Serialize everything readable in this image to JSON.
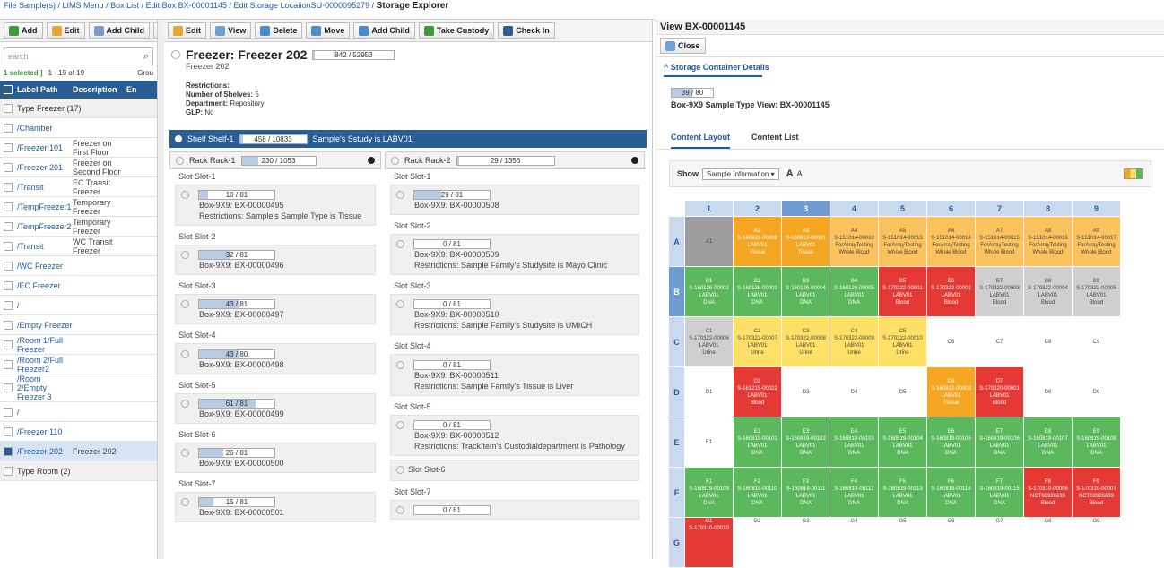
{
  "breadcrumb": {
    "items": [
      "File Sample(s)",
      "LIMS Menu",
      "Box List",
      "Edit Box BX-00001145",
      "Edit Storage LocationSU-0000095279"
    ],
    "current": "Storage Explorer"
  },
  "left_toolbar": {
    "add": "Add",
    "edit": "Edit",
    "add_child": "Add Child",
    "more": "L"
  },
  "left": {
    "search_placeholder": "earch",
    "selected": "1 selected ]",
    "range": "1 - 19 of 19",
    "group_label": "Grou",
    "col_label_path": "Label Path",
    "col_description": "Description",
    "col_extra": "En",
    "rows": [
      {
        "path": "Type Freezer (17)",
        "desc": "",
        "group": true,
        "checked": false
      },
      {
        "path": "/Chamber",
        "desc": "",
        "checked": false
      },
      {
        "path": "/Freezer 101",
        "desc": "Freezer on First Floor",
        "checked": false
      },
      {
        "path": "/Freezer 201",
        "desc": "Freezer on Second Floor",
        "checked": false
      },
      {
        "path": "/Transit",
        "desc": "EC Transit Freezer",
        "checked": false
      },
      {
        "path": "/TempFreezer1",
        "desc": "Temporary Freezer",
        "checked": false
      },
      {
        "path": "/TempFreezer2",
        "desc": "Temporary Freezer",
        "checked": false
      },
      {
        "path": "/Transit",
        "desc": "WC Transit Freezer",
        "checked": false
      },
      {
        "path": "/WC Freezer",
        "desc": "",
        "checked": false
      },
      {
        "path": "/EC Freezer",
        "desc": "",
        "checked": false
      },
      {
        "path": "/",
        "desc": "",
        "checked": false
      },
      {
        "path": "/Empty Freezer",
        "desc": "",
        "checked": false
      },
      {
        "path": "/Room 1/Full Freezer",
        "desc": "",
        "checked": false
      },
      {
        "path": "/Room 2/Full Freezer2",
        "desc": "",
        "checked": false
      },
      {
        "path": "/Room 2/Empty Freezer 3",
        "desc": "",
        "checked": false
      },
      {
        "path": "/",
        "desc": "",
        "checked": false
      },
      {
        "path": "/Freezer 110",
        "desc": "",
        "checked": false
      },
      {
        "path": "/Freezer 202",
        "desc": "Freezer 202",
        "checked": true
      },
      {
        "path": "Type Room (2)",
        "desc": "",
        "group": true,
        "checked": false
      }
    ]
  },
  "mid_toolbar": {
    "edit": "Edit",
    "view": "View",
    "delete": "Delete",
    "move": "Move",
    "add_child": "Add Child",
    "take_custody": "Take Custody",
    "check_in": "Check In"
  },
  "freezer": {
    "title": "Freezer: Freezer 202",
    "capacity": "842 / 52953",
    "capacity_fill": 0.016,
    "subtitle": "Freezer 202",
    "restrictions": "Restrictions:",
    "shelves_label": "Number of Shelves:",
    "shelves": "5",
    "dept_label": "Department:",
    "dept": "Repository",
    "glp_label": "GLP:",
    "glp": "No"
  },
  "shelf": {
    "label": "Shelf Shelf-1",
    "capacity": "458 / 10833",
    "fill": 0.042,
    "note": "Sample's Sstudy is LABV01"
  },
  "rack1": {
    "label": "Rack Rack-1",
    "capacity": "230 / 1053",
    "fill": 0.22,
    "slots": [
      {
        "label": "Slot Slot-1",
        "cap": "10 / 81",
        "fill": 0.12,
        "box": "Box-9X9: BX-00000495",
        "restr": "Restrictions: Sample's Sample Type is Tissue"
      },
      {
        "label": "Slot Slot-2",
        "cap": "32 / 81",
        "fill": 0.4,
        "box": "Box-9X9: BX-00000496",
        "restr": ""
      },
      {
        "label": "Slot Slot-3",
        "cap": "43 / 81",
        "fill": 0.53,
        "box": "Box-9X9: BX-00000497",
        "restr": ""
      },
      {
        "label": "Slot Slot-4",
        "cap": "43 / 80",
        "fill": 0.54,
        "box": "Box-9X9: BX-00000498",
        "restr": ""
      },
      {
        "label": "Slot Slot-5",
        "cap": "61 / 81",
        "fill": 0.75,
        "box": "Box-9X9: BX-00000499",
        "restr": ""
      },
      {
        "label": "Slot Slot-6",
        "cap": "26 / 81",
        "fill": 0.32,
        "box": "Box-9X9: BX-00000500",
        "restr": ""
      },
      {
        "label": "Slot Slot-7",
        "cap": "15 / 81",
        "fill": 0.19,
        "box": "Box-9X9: BX-00000501",
        "restr": ""
      }
    ]
  },
  "rack2": {
    "label": "Rack Rack-2",
    "capacity": "29 / 1356",
    "fill": 0.02,
    "slots": [
      {
        "label": "Slot Slot-1",
        "cap": "29 / 81",
        "fill": 0.36,
        "box": "Box-9X9: BX-00000508",
        "restr": ""
      },
      {
        "label": "Slot Slot-2",
        "cap": "0 / 81",
        "fill": 0,
        "box": "Box-9X9: BX-00000509",
        "restr": "Restrictions: Sample Family's Studysite is Mayo Clinic"
      },
      {
        "label": "Slot Slot-3",
        "cap": "0 / 81",
        "fill": 0,
        "box": "Box-9X9: BX-00000510",
        "restr": "Restrictions: Sample Family's Studysite is UMICH"
      },
      {
        "label": "Slot Slot-4",
        "cap": "0 / 81",
        "fill": 0,
        "box": "Box-9X9: BX-00000511",
        "restr": "Restrictions: Sample Family's Tissue is Liver"
      },
      {
        "label": "Slot Slot-5",
        "cap": "0 / 81",
        "fill": 0,
        "box": "Box-9X9: BX-00000512",
        "restr": "Restrictions: TrackItem's Custodialdepartment is Pathology"
      },
      {
        "label": "Slot Slot-6",
        "cap": "",
        "fill": 0,
        "box": "",
        "restr": ""
      },
      {
        "label": "Slot Slot-7",
        "cap": "0 / 81",
        "fill": 0,
        "box": "",
        "restr": ""
      }
    ]
  },
  "view": {
    "title": "View BX-00001145",
    "close": "Close",
    "section": "Storage Container Details",
    "capacity": "39 / 80",
    "fill": 0.49,
    "box_type": "Box-9X9 Sample Type View: BX-00001145",
    "tab_layout": "Content Layout",
    "tab_list": "Content List",
    "show_label": "Show",
    "show_value": "Sample Information",
    "font_up": "A",
    "font_down": "A"
  },
  "colors": {
    "gray": "#9e9e9e",
    "orange": "#f5a623",
    "yellow": "#ffe066",
    "green": "#5cb85c",
    "red": "#e53935",
    "lightgray": "#cfcfcf",
    "white": "#ffffff",
    "orange2": "#fbc25d"
  },
  "grid": {
    "cols": [
      "1",
      "2",
      "3",
      "4",
      "5",
      "6",
      "7",
      "8",
      "9"
    ],
    "rows": [
      {
        "label": "A",
        "cells": [
          {
            "pos": "A1",
            "lines": [],
            "c": "gray"
          },
          {
            "pos": "A2",
            "lines": [
              "S-160812-00002",
              "LABV01",
              "Tissue"
            ],
            "c": "orange"
          },
          {
            "pos": "A3",
            "lines": [
              "S-160812-00001",
              "LABV01",
              "Tissue"
            ],
            "c": "orange"
          },
          {
            "pos": "A4",
            "lines": [
              "S-151014-00012",
              "ForArrayTesting",
              "Whole Blood"
            ],
            "c": "orange2"
          },
          {
            "pos": "A5",
            "lines": [
              "S-151014-00013",
              "ForArrayTesting",
              "Whole Blood"
            ],
            "c": "orange2"
          },
          {
            "pos": "A6",
            "lines": [
              "S-151014-00014",
              "ForArrayTesting",
              "Whole Blood"
            ],
            "c": "orange2"
          },
          {
            "pos": "A7",
            "lines": [
              "S-151014-00015",
              "ForArrayTesting",
              "Whole Blood"
            ],
            "c": "orange2"
          },
          {
            "pos": "A8",
            "lines": [
              "S-151014-00016",
              "ForArrayTesting",
              "Whole Blood"
            ],
            "c": "orange2"
          },
          {
            "pos": "A9",
            "lines": [
              "S-151014-00017",
              "ForArrayTesting",
              "Whole Blood"
            ],
            "c": "orange2"
          }
        ]
      },
      {
        "label": "B",
        "cells": [
          {
            "pos": "B1",
            "lines": [
              "S-160126-00002",
              "LABV01",
              "DNA"
            ],
            "c": "green"
          },
          {
            "pos": "B2",
            "lines": [
              "S-160126-00003",
              "LABV01",
              "DNA"
            ],
            "c": "green"
          },
          {
            "pos": "B3",
            "lines": [
              "S-160126-00004",
              "LABV01",
              "DNA"
            ],
            "c": "green"
          },
          {
            "pos": "B4",
            "lines": [
              "S-160126-00005",
              "LABV01",
              "DNA"
            ],
            "c": "green"
          },
          {
            "pos": "B5",
            "lines": [
              "S-170322-00001",
              "LABV01",
              "Blood"
            ],
            "c": "red"
          },
          {
            "pos": "B6",
            "lines": [
              "S-170322-00002",
              "LABV01",
              "Blood"
            ],
            "c": "red"
          },
          {
            "pos": "B7",
            "lines": [
              "S-170322-00003",
              "LABV01",
              "Blood"
            ],
            "c": "lightgray"
          },
          {
            "pos": "B8",
            "lines": [
              "S-170322-00004",
              "LABV01",
              "Blood"
            ],
            "c": "lightgray"
          },
          {
            "pos": "B9",
            "lines": [
              "S-170322-00005",
              "LABV01",
              "Blood"
            ],
            "c": "lightgray"
          }
        ]
      },
      {
        "label": "C",
        "cells": [
          {
            "pos": "C1",
            "lines": [
              "S-170322-00006",
              "LABV01",
              "Urine"
            ],
            "c": "lightgray"
          },
          {
            "pos": "C2",
            "lines": [
              "S-170322-00007",
              "LABV01",
              "Urine"
            ],
            "c": "yellow"
          },
          {
            "pos": "C3",
            "lines": [
              "S-170322-00008",
              "LABV01",
              "Urine"
            ],
            "c": "yellow"
          },
          {
            "pos": "C4",
            "lines": [
              "S-170322-00009",
              "LABV01",
              "Urine"
            ],
            "c": "yellow"
          },
          {
            "pos": "C5",
            "lines": [
              "S-170322-00010",
              "LABV01",
              "Urine"
            ],
            "c": "yellow"
          },
          {
            "pos": "C6",
            "lines": [],
            "c": "white"
          },
          {
            "pos": "C7",
            "lines": [],
            "c": "white"
          },
          {
            "pos": "C8",
            "lines": [],
            "c": "white"
          },
          {
            "pos": "C9",
            "lines": [],
            "c": "white"
          }
        ]
      },
      {
        "label": "D",
        "cells": [
          {
            "pos": "D1",
            "lines": [],
            "c": "white"
          },
          {
            "pos": "D2",
            "lines": [
              "S-161215-00022",
              "LABV01",
              "Blood"
            ],
            "c": "red"
          },
          {
            "pos": "D3",
            "lines": [],
            "c": "white"
          },
          {
            "pos": "D4",
            "lines": [],
            "c": "white"
          },
          {
            "pos": "D5",
            "lines": [],
            "c": "white"
          },
          {
            "pos": "D6",
            "lines": [
              "S-160812-00003",
              "LABV01",
              "Tissue"
            ],
            "c": "orange"
          },
          {
            "pos": "D7",
            "lines": [
              "S-170320-00001",
              "LABV01",
              "Blood"
            ],
            "c": "red"
          },
          {
            "pos": "D8",
            "lines": [],
            "c": "white"
          },
          {
            "pos": "D9",
            "lines": [],
            "c": "white"
          }
        ]
      },
      {
        "label": "E",
        "cells": [
          {
            "pos": "E1",
            "lines": [],
            "c": "white"
          },
          {
            "pos": "E2",
            "lines": [
              "S-160819-00101",
              "LABV01",
              "DNA"
            ],
            "c": "green"
          },
          {
            "pos": "E3",
            "lines": [
              "S-160819-00102",
              "LABV01",
              "DNA"
            ],
            "c": "green"
          },
          {
            "pos": "E4",
            "lines": [
              "S-160819-00103",
              "LABV01",
              "DNA"
            ],
            "c": "green"
          },
          {
            "pos": "E5",
            "lines": [
              "S-160819-00104",
              "LABV01",
              "DNA"
            ],
            "c": "green"
          },
          {
            "pos": "E6",
            "lines": [
              "S-160819-00105",
              "LABV01",
              "DNA"
            ],
            "c": "green"
          },
          {
            "pos": "E7",
            "lines": [
              "S-160819-00106",
              "LABV01",
              "DNA"
            ],
            "c": "green"
          },
          {
            "pos": "E8",
            "lines": [
              "S-160819-00107",
              "LABV01",
              "DNA"
            ],
            "c": "green"
          },
          {
            "pos": "E9",
            "lines": [
              "S-160819-00108",
              "LABV01",
              "DNA"
            ],
            "c": "green"
          }
        ]
      },
      {
        "label": "F",
        "cells": [
          {
            "pos": "F1",
            "lines": [
              "S-160819-00109",
              "LABV01",
              "DNA"
            ],
            "c": "green"
          },
          {
            "pos": "F2",
            "lines": [
              "S-160819-00110",
              "LABV01",
              "DNA"
            ],
            "c": "green"
          },
          {
            "pos": "F3",
            "lines": [
              "S-160819-00111",
              "LABV01",
              "DNA"
            ],
            "c": "green"
          },
          {
            "pos": "F4",
            "lines": [
              "S-160819-00112",
              "LABV01",
              "DNA"
            ],
            "c": "green"
          },
          {
            "pos": "F5",
            "lines": [
              "S-160819-00113",
              "LABV01",
              "DNA"
            ],
            "c": "green"
          },
          {
            "pos": "F6",
            "lines": [
              "S-160819-00114",
              "LABV01",
              "DNA"
            ],
            "c": "green"
          },
          {
            "pos": "F7",
            "lines": [
              "S-160819-00115",
              "LABV01",
              "DNA"
            ],
            "c": "green"
          },
          {
            "pos": "F8",
            "lines": [
              "S-170310-00006",
              "NCT02926633",
              "Blood"
            ],
            "c": "red"
          },
          {
            "pos": "F9",
            "lines": [
              "S-170310-00007",
              "NCT02926633",
              "Blood"
            ],
            "c": "red"
          }
        ]
      },
      {
        "label": "G",
        "cells": [
          {
            "pos": "G1",
            "lines": [
              "S-170310-00010"
            ],
            "c": "red"
          },
          {
            "pos": "G2",
            "lines": [],
            "c": "white"
          },
          {
            "pos": "G3",
            "lines": [],
            "c": "white"
          },
          {
            "pos": "G4",
            "lines": [],
            "c": "white"
          },
          {
            "pos": "G5",
            "lines": [],
            "c": "white"
          },
          {
            "pos": "G6",
            "lines": [],
            "c": "white"
          },
          {
            "pos": "G7",
            "lines": [],
            "c": "white"
          },
          {
            "pos": "G8",
            "lines": [],
            "c": "white"
          },
          {
            "pos": "G9",
            "lines": [],
            "c": "white"
          }
        ]
      }
    ]
  }
}
